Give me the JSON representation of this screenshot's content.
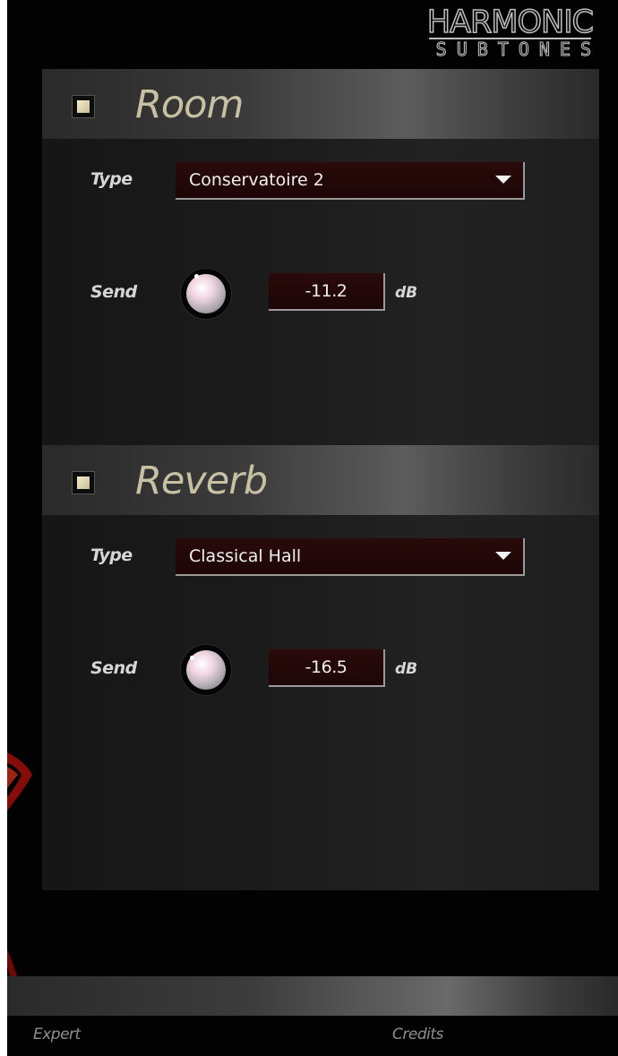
{
  "logo": {
    "top": "HARMONIC",
    "bottom": "SUBTONES"
  },
  "sections": [
    {
      "title": "Room",
      "enabled": true,
      "type_label": "Type",
      "type_value": "Conservatoire 2",
      "send_label": "Send",
      "send_value": "-11.2",
      "send_unit": "dB"
    },
    {
      "title": "Reverb",
      "enabled": true,
      "type_label": "Type",
      "type_value": "Classical Hall",
      "send_label": "Send",
      "send_value": "-16.5",
      "send_unit": "dB"
    }
  ],
  "footer": {
    "expert_label": "Expert",
    "credits_label": "Credits"
  },
  "colors": {
    "background": "#020202",
    "title_text": "#c7c0a3",
    "field_bg": "#2a0a0a",
    "checkbox_fill": "#e8dfbf",
    "accent_red": "#b0130c"
  },
  "icons": {
    "dropdown_arrow": "triangle-down",
    "knob": "rotary-knob",
    "checkbox": "square-check"
  }
}
